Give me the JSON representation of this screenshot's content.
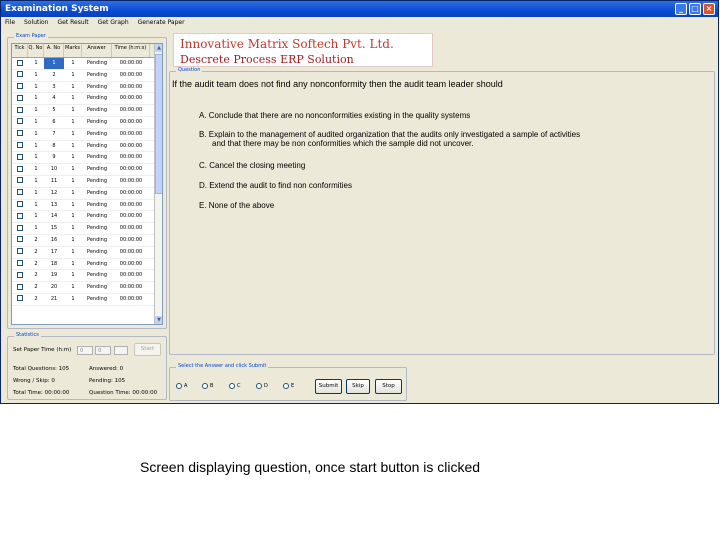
{
  "window": {
    "title": "Examination System"
  },
  "menu": [
    "File",
    "Solution",
    "Get Result",
    "Get Graph",
    "Generate Paper"
  ],
  "exam_paper": {
    "group_title": "Exam Paper",
    "columns": [
      "Tick",
      "Q. No",
      "A. No",
      "Marks",
      "Answer",
      "Time (h:m:s)"
    ],
    "rows": [
      {
        "q": "1",
        "a": "1",
        "marks": "1",
        "answer": "Pending",
        "time": "00:00:00",
        "selected": true
      },
      {
        "q": "1",
        "a": "2",
        "marks": "1",
        "answer": "Pending",
        "time": "00:00:00"
      },
      {
        "q": "1",
        "a": "3",
        "marks": "1",
        "answer": "Pending",
        "time": "00:00:00"
      },
      {
        "q": "1",
        "a": "4",
        "marks": "1",
        "answer": "Pending",
        "time": "00:00:00"
      },
      {
        "q": "1",
        "a": "5",
        "marks": "1",
        "answer": "Pending",
        "time": "00:00:00"
      },
      {
        "q": "1",
        "a": "6",
        "marks": "1",
        "answer": "Pending",
        "time": "00:00:00"
      },
      {
        "q": "1",
        "a": "7",
        "marks": "1",
        "answer": "Pending",
        "time": "00:00:00"
      },
      {
        "q": "1",
        "a": "8",
        "marks": "1",
        "answer": "Pending",
        "time": "00:00:00"
      },
      {
        "q": "1",
        "a": "9",
        "marks": "1",
        "answer": "Pending",
        "time": "00:00:00"
      },
      {
        "q": "1",
        "a": "10",
        "marks": "1",
        "answer": "Pending",
        "time": "00:00:00"
      },
      {
        "q": "1",
        "a": "11",
        "marks": "1",
        "answer": "Pending",
        "time": "00:00:00"
      },
      {
        "q": "1",
        "a": "12",
        "marks": "1",
        "answer": "Pending",
        "time": "00:00:00"
      },
      {
        "q": "1",
        "a": "13",
        "marks": "1",
        "answer": "Pending",
        "time": "00:00:00"
      },
      {
        "q": "1",
        "a": "14",
        "marks": "1",
        "answer": "Pending",
        "time": "00:00:00"
      },
      {
        "q": "1",
        "a": "15",
        "marks": "1",
        "answer": "Pending",
        "time": "00:00:00"
      },
      {
        "q": "2",
        "a": "16",
        "marks": "1",
        "answer": "Pending",
        "time": "00:00:00"
      },
      {
        "q": "2",
        "a": "17",
        "marks": "1",
        "answer": "Pending",
        "time": "00:00:00"
      },
      {
        "q": "2",
        "a": "18",
        "marks": "1",
        "answer": "Pending",
        "time": "00:00:00"
      },
      {
        "q": "2",
        "a": "19",
        "marks": "1",
        "answer": "Pending",
        "time": "00:00:00"
      },
      {
        "q": "2",
        "a": "20",
        "marks": "1",
        "answer": "Pending",
        "time": "00:00:00"
      },
      {
        "q": "2",
        "a": "21",
        "marks": "1",
        "answer": "Pending",
        "time": "00:00:00"
      }
    ]
  },
  "statistics": {
    "group_title": "Statistics",
    "set_label": "Set Paper Time (h:m)",
    "hours": "0",
    "minutes": "0",
    "start_label": "Start",
    "total_questions": "Total Questions: 105",
    "attempted": "Answered: 0",
    "wrong": "Wrong / Skip: 0",
    "pending": "Pending: 105",
    "total_time": "Total Time: 00:00:00",
    "question_time": "Question Time: 00:00:00"
  },
  "logo": {
    "line1": "Innovative Matrix Softech Pvt. Ltd.",
    "line2": "Descrete Process ERP Solution"
  },
  "question": {
    "group_title": "Question",
    "text": "If the audit team does not find any nonconformity then the audit team leader should",
    "options": [
      "A. Conclude that there are no nonconformities existing in the quality systems",
      "B. Explain to the management of audited organization that the audits only investigated a sample of activities",
      "and that there may be non conformities which the sample did not uncover.",
      "C. Cancel the closing meeting",
      "D. Extend the audit to find non conformities",
      "E. None of the above"
    ]
  },
  "answer_bar": {
    "group_title": "Select the Answer and click Submit",
    "choices": [
      "A",
      "B",
      "C",
      "D",
      "E"
    ],
    "submit_label": "Submit",
    "skip_label": "Skip",
    "stop_label": "Stop"
  },
  "caption": "Screen displaying question, once start button is clicked"
}
